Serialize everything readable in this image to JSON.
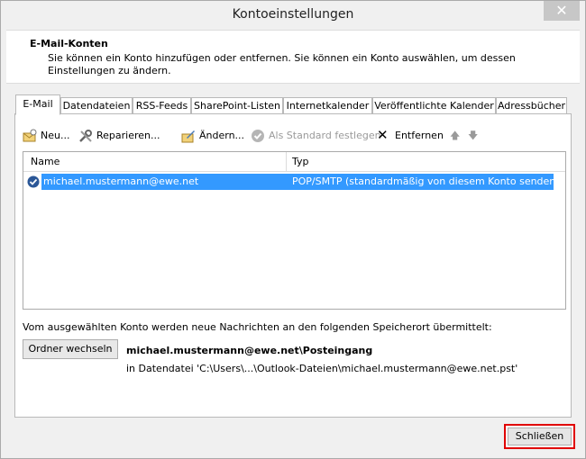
{
  "window": {
    "title": "Kontoeinstellungen",
    "close_glyph": "✕"
  },
  "header": {
    "title": "E-Mail-Konten",
    "description": "Sie können ein Konto hinzufügen oder entfernen. Sie können ein Konto auswählen, um dessen Einstellungen zu ändern."
  },
  "tabs": [
    {
      "label": "E-Mail"
    },
    {
      "label": "Datendateien"
    },
    {
      "label": "RSS-Feeds"
    },
    {
      "label": "SharePoint-Listen"
    },
    {
      "label": "Internetkalender"
    },
    {
      "label": "Veröffentlichte Kalender"
    },
    {
      "label": "Adressbücher"
    }
  ],
  "toolbar": {
    "new_label": "Neu...",
    "repair_label": "Reparieren...",
    "change_label": "Ändern...",
    "set_default_label": "Als Standard festlegen",
    "remove_label": "Entfernen",
    "remove_glyph": "✕",
    "up_glyph": "🡅",
    "down_glyph": "🡇"
  },
  "account_list": {
    "col_name": "Name",
    "col_type": "Typ",
    "rows": [
      {
        "name": "michael.mustermann@ewe.net",
        "type": "POP/SMTP (standardmäßig von diesem Konto senden)"
      }
    ]
  },
  "storage": {
    "info": "Vom ausgewählten Konto werden neue Nachrichten an den folgenden Speicherort übermittelt:",
    "change_folder_label": "Ordner wechseln",
    "path": "michael.mustermann@ewe.net\\Posteingang",
    "data_file": "in Datendatei 'C:\\Users\\...\\Outlook-Dateien\\michael.mustermann@ewe.net.pst'"
  },
  "footer": {
    "close_label": "Schließen"
  },
  "colors": {
    "selection": "#3399ff",
    "highlight_border": "#e00000"
  }
}
